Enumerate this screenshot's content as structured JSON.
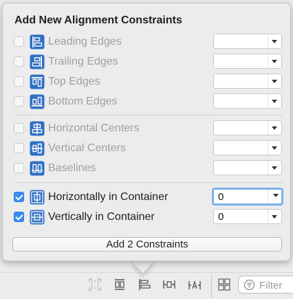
{
  "popover": {
    "title": "Add New Alignment Constraints",
    "rows": [
      {
        "label": "Leading Edges",
        "checked": false,
        "enabled": false,
        "value": "",
        "icon": "leading-edges-icon"
      },
      {
        "label": "Trailing Edges",
        "checked": false,
        "enabled": false,
        "value": "",
        "icon": "trailing-edges-icon"
      },
      {
        "label": "Top Edges",
        "checked": false,
        "enabled": false,
        "value": "",
        "icon": "top-edges-icon"
      },
      {
        "label": "Bottom Edges",
        "checked": false,
        "enabled": false,
        "value": "",
        "icon": "bottom-edges-icon"
      },
      {
        "label": "Horizontal Centers",
        "checked": false,
        "enabled": false,
        "value": "",
        "icon": "horizontal-centers-icon"
      },
      {
        "label": "Vertical Centers",
        "checked": false,
        "enabled": false,
        "value": "",
        "icon": "vertical-centers-icon"
      },
      {
        "label": "Baselines",
        "checked": false,
        "enabled": false,
        "value": "",
        "icon": "baselines-icon"
      },
      {
        "label": "Horizontally in Container",
        "checked": true,
        "enabled": true,
        "value": "0",
        "icon": "horizontally-in-container-icon"
      },
      {
        "label": "Vertically in Container",
        "checked": true,
        "enabled": true,
        "value": "0",
        "icon": "vertically-in-container-icon"
      }
    ],
    "add_button_label": "Add 2 Constraints"
  },
  "bottom_bar": {
    "filter_placeholder": "Filter",
    "icons": [
      "update-frames-icon",
      "stack-icon",
      "align-icon",
      "pin-icon",
      "resolve-auto-layout-icon",
      "grid-icon",
      "filter-icon"
    ]
  },
  "colors": {
    "accent": "#3a8cf5",
    "icon_blue": "#2f6fc4",
    "disabled_text": "#a0a0a0",
    "focus_ring": "#7db1ec"
  }
}
